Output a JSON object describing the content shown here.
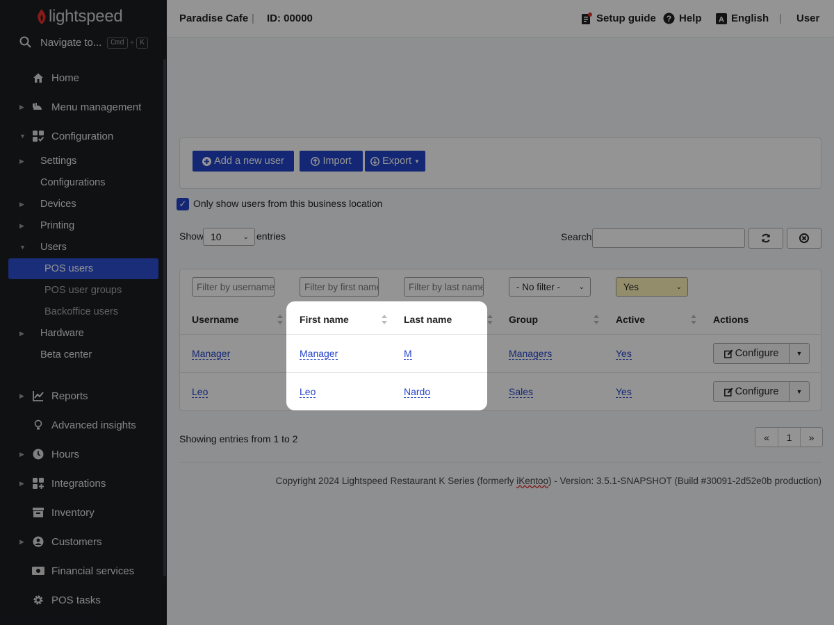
{
  "brand": {
    "name": "lightspeed"
  },
  "sidebar": {
    "search_label": "Navigate to...",
    "shortcut_keys": [
      "Cmd",
      "+",
      "K"
    ],
    "items": [
      {
        "label": "Home"
      },
      {
        "label": "Menu management"
      },
      {
        "label": "Configuration"
      },
      {
        "label": "Reports"
      },
      {
        "label": "Advanced insights"
      },
      {
        "label": "Hours"
      },
      {
        "label": "Integrations"
      },
      {
        "label": "Inventory"
      },
      {
        "label": "Customers"
      },
      {
        "label": "Financial services"
      },
      {
        "label": "POS tasks"
      }
    ],
    "config_children": [
      {
        "label": "Settings"
      },
      {
        "label": "Configurations"
      },
      {
        "label": "Devices"
      },
      {
        "label": "Printing"
      },
      {
        "label": "Users"
      },
      {
        "label": "Hardware"
      },
      {
        "label": "Beta center"
      }
    ],
    "users_children": [
      {
        "label": "POS users"
      },
      {
        "label": "POS user groups"
      },
      {
        "label": "Backoffice users"
      }
    ]
  },
  "header": {
    "venue": "Paradise Cafe",
    "separator": "|",
    "id_label": "ID: 00000",
    "setup_guide": "Setup guide",
    "help": "Help",
    "language": "English",
    "user": "User"
  },
  "toolbar": {
    "add_user": "Add a new user",
    "import": "Import",
    "export": "Export"
  },
  "filter_checkbox": {
    "label": "Only show users from this business location",
    "checked": true
  },
  "table_controls": {
    "show_label": "Show",
    "page_size": "10",
    "entries_label": "entries",
    "search_label": "Search:"
  },
  "filters": {
    "username_placeholder": "Filter by username",
    "first_name_placeholder": "Filter by first name",
    "last_name_placeholder": "Filter by last name",
    "group_value": "- No filter -",
    "active_value": "Yes"
  },
  "table": {
    "columns": [
      "Username",
      "First name",
      "Last name",
      "Group",
      "Active",
      "Actions"
    ],
    "rows": [
      {
        "username": "Manager",
        "first_name": "Manager",
        "last_name": "M",
        "group": "Managers",
        "active": "Yes",
        "action": "Configure"
      },
      {
        "username": "Leo",
        "first_name": "Leo",
        "last_name": "Nardo",
        "group": "Sales",
        "active": "Yes",
        "action": "Configure"
      }
    ]
  },
  "footer": {
    "showing": "Showing entries from 1 to 2",
    "pager": [
      "«",
      "1",
      "»"
    ],
    "copyright_pre": "Copyright 2024 Lightspeed Restaurant K Series (formerly ",
    "copyright_brand": "iKentoo",
    "copyright_post": ") - Version: 3.5.1-SNAPSHOT (Build #30091-2d52e0b production)"
  },
  "colors": {
    "accent": "#2444c8",
    "sidebar_bg": "#1c1e22",
    "active_filter": "#fff3b8"
  }
}
